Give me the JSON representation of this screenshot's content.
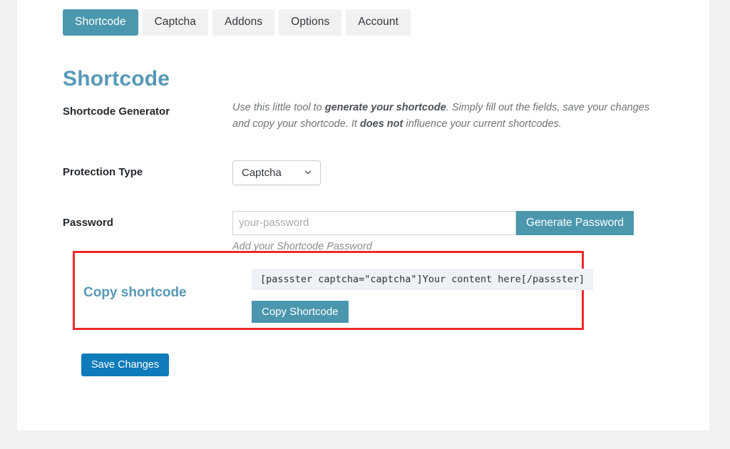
{
  "tabs": [
    {
      "label": "Shortcode",
      "active": true
    },
    {
      "label": "Captcha",
      "active": false
    },
    {
      "label": "Addons",
      "active": false
    },
    {
      "label": "Options",
      "active": false
    },
    {
      "label": "Account",
      "active": false
    }
  ],
  "page": {
    "title": "Shortcode"
  },
  "rows": {
    "generator": {
      "label": "Shortcode Generator",
      "desc_1": "Use this little tool to ",
      "desc_b1": "generate your shortcode",
      "desc_2": ". Simply fill out the fields, save your changes and copy your shortcode. It ",
      "desc_b2": "does not",
      "desc_3": " influence your current shortcodes."
    },
    "protection_type": {
      "label": "Protection Type",
      "selected": "Captcha",
      "options": [
        "Captcha"
      ],
      "icon": "chevron-down-icon"
    },
    "password": {
      "label": "Password",
      "value": "",
      "placeholder": "your-password",
      "generate_label": "Generate Password",
      "help": "Add your Shortcode Password"
    }
  },
  "copy_block": {
    "label": "Copy shortcode",
    "shortcode": "[passster captcha=\"captcha\"]Your content here[/passster]",
    "copy_label": "Copy Shortcode",
    "highlight_color": "#ef2a2a"
  },
  "footer": {
    "save_label": "Save Changes"
  },
  "colors": {
    "accent_teal": "#4b97ae",
    "heading_blue": "#5799b7",
    "primary_blue": "#0f7bba",
    "page_bg": "#f1f1f1",
    "panel_bg": "#ffffff",
    "code_bg": "#eef1f6"
  }
}
